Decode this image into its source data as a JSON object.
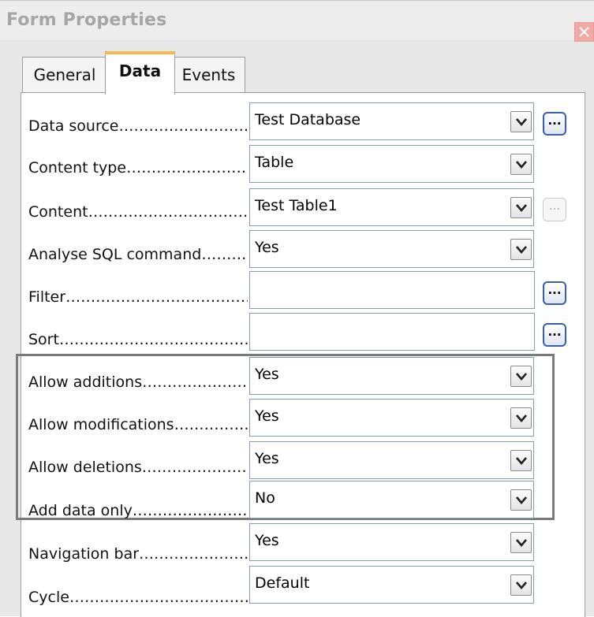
{
  "window": {
    "title": "Form Properties"
  },
  "tabs": [
    {
      "label": "General"
    },
    {
      "label": "Data"
    },
    {
      "label": "Events"
    }
  ],
  "rows": [
    {
      "label": "Data source",
      "value": "Test Database",
      "browse": "...",
      "browse_enabled": true
    },
    {
      "label": "Content type",
      "value": "Table"
    },
    {
      "label": "Content",
      "value": "Test Table1",
      "browse": "...",
      "browse_enabled": false
    },
    {
      "label": "Analyse SQL command",
      "value": "Yes"
    },
    {
      "label": "Filter",
      "value": "",
      "browse": "...",
      "browse_enabled": true
    },
    {
      "label": "Sort",
      "value": "",
      "browse": "...",
      "browse_enabled": true
    },
    {
      "label": "Allow additions",
      "value": "Yes"
    },
    {
      "label": "Allow modifications",
      "value": "Yes"
    },
    {
      "label": "Allow deletions",
      "value": "Yes"
    },
    {
      "label": "Add data only",
      "value": "No"
    },
    {
      "label": "Navigation bar",
      "value": "Yes"
    },
    {
      "label": "Cycle",
      "value": "Default"
    }
  ],
  "colors": {
    "accent_tab": "#f7b94b",
    "close_button": "#f0a9a4",
    "group_border": "#7a7a7a"
  },
  "icons": {
    "close": "close-icon",
    "dropdown": "chevron-down-icon"
  }
}
